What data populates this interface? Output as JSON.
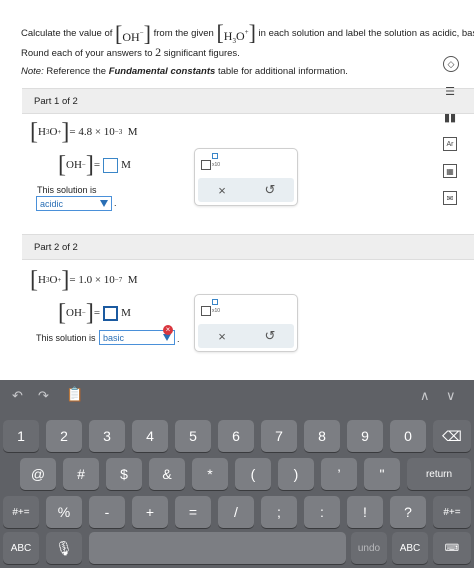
{
  "question": {
    "calc": "Calculate the value of",
    "oh": "OH",
    "oh_charge": "−",
    "from_given": "from the given",
    "h3o": "H",
    "h3o_sub": "3",
    "h3o_o": "O",
    "h3o_charge": "+",
    "rest": "in each solution and label the solution as acidic, basic,",
    "round_pre": "Round each of your answers to",
    "round_num": "2",
    "round_post": "significant figures.",
    "note_label": "Note:",
    "note_text": "Reference the",
    "note_bold": "Fundamental constants",
    "note_post": "table for additional information."
  },
  "part1": {
    "title": "Part 1 of 2",
    "given_value": "= 4.8 × 10",
    "given_exp": "−3",
    "unit": "M",
    "eq_sign": "=",
    "solution_label": "This solution is",
    "selected": "acidic",
    "x10": "x10"
  },
  "part2": {
    "title": "Part 2 of 2",
    "given_value": "= 1.0 × 10",
    "given_exp": "−7",
    "unit": "M",
    "eq_sign": "=",
    "solution_label": "This solution is",
    "selected": "basic",
    "x10": "x10"
  },
  "toolbox": {
    "clear": "×",
    "undo": "↺"
  },
  "keyboard": {
    "row1": [
      "1",
      "2",
      "3",
      "4",
      "5",
      "6",
      "7",
      "8",
      "9",
      "0"
    ],
    "row2": [
      "@",
      "#",
      "$",
      "&",
      "*",
      "(",
      ")",
      "’",
      "\""
    ],
    "row3": [
      "%",
      "-",
      "+",
      "=",
      "/",
      ";",
      ":",
      "!",
      "?"
    ],
    "shift": "#+=",
    "return": "return",
    "abc": "ABC",
    "undo": "undo"
  }
}
